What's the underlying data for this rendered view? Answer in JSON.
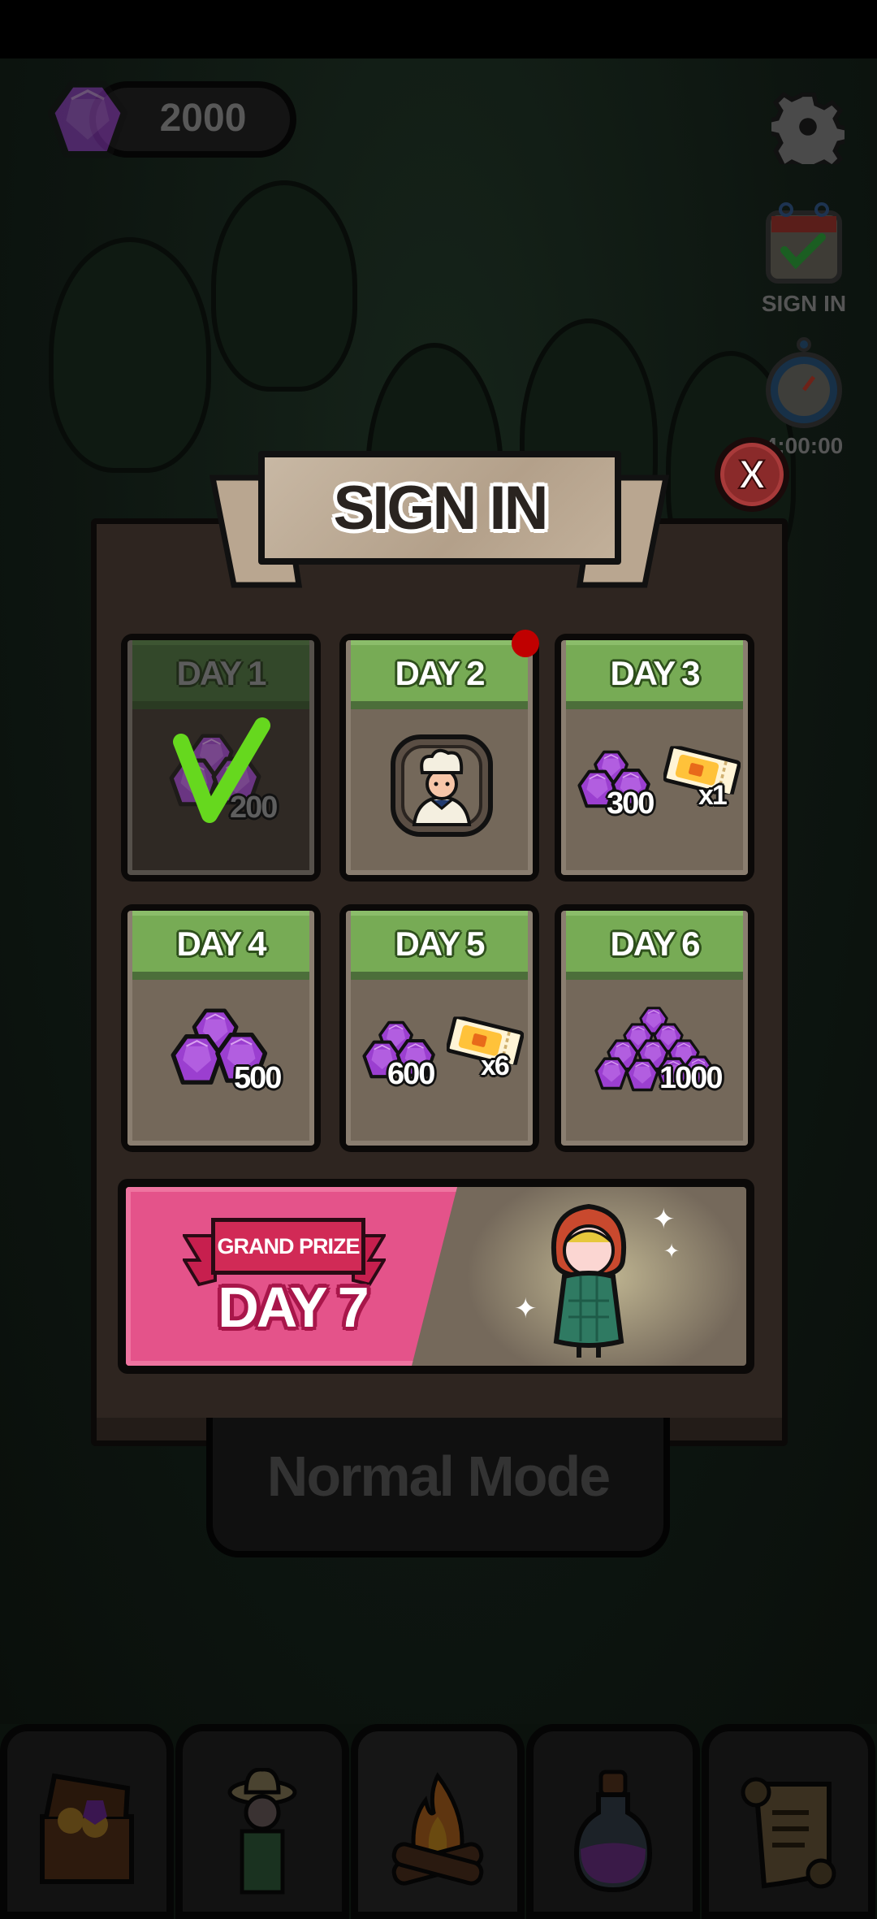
{
  "hud": {
    "gem_count": "2000",
    "sign_in_label": "SIGN IN",
    "timer": "4:00:00"
  },
  "dialog": {
    "title": "SIGN IN",
    "close_label": "X",
    "days": [
      {
        "label": "DAY 1",
        "reward": "200",
        "claimed": true
      },
      {
        "label": "DAY 2",
        "reward_type": "character",
        "notify": true
      },
      {
        "label": "DAY 3",
        "reward": "300",
        "ticket": "x1"
      },
      {
        "label": "DAY 4",
        "reward": "500"
      },
      {
        "label": "DAY 5",
        "reward": "600",
        "ticket": "x6"
      },
      {
        "label": "DAY 6",
        "reward": "1000"
      }
    ],
    "grand_prize": {
      "label": "GRAND PRIZE",
      "day": "DAY 7"
    }
  },
  "mode_button": "Normal Mode",
  "nav": [
    "treasure-chest",
    "farmer",
    "campfire",
    "potion",
    "scroll"
  ],
  "colors": {
    "card_header": "#77ab55",
    "grand_pink": "#e4538a",
    "close_red": "#8a2a2a",
    "gem": "#9b3fd0"
  }
}
